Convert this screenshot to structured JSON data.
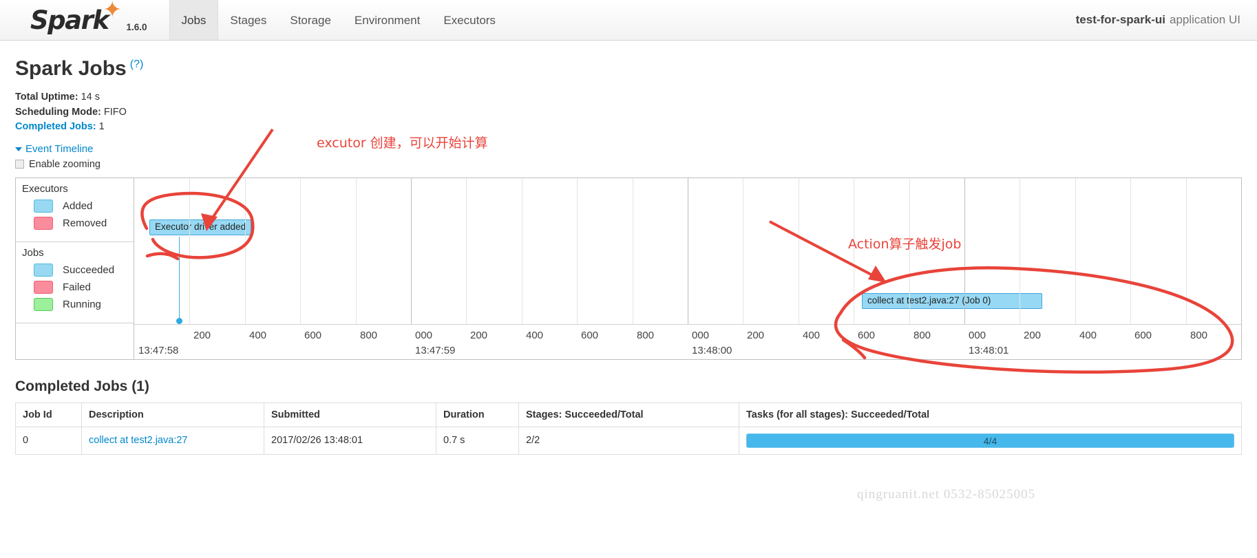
{
  "navbar": {
    "brand": "Spark",
    "version": "1.6.0",
    "tabs": [
      {
        "label": "Jobs",
        "active": true
      },
      {
        "label": "Stages",
        "active": false
      },
      {
        "label": "Storage",
        "active": false
      },
      {
        "label": "Environment",
        "active": false
      },
      {
        "label": "Executors",
        "active": false
      }
    ],
    "app_name": "test-for-spark-ui",
    "app_suffix": "application UI"
  },
  "page": {
    "title": "Spark Jobs",
    "help_marker": "(?)",
    "total_uptime_label": "Total Uptime:",
    "total_uptime_value": "14 s",
    "scheduling_mode_label": "Scheduling Mode:",
    "scheduling_mode_value": "FIFO",
    "completed_jobs_label": "Completed Jobs:",
    "completed_jobs_value": "1",
    "event_timeline_label": "Event Timeline",
    "enable_zooming_label": "Enable zooming"
  },
  "timeline": {
    "legend": {
      "executors_header": "Executors",
      "executors_items": [
        {
          "label": "Added",
          "color": "#98d9f1"
        },
        {
          "label": "Removed",
          "color": "#fa8c9b"
        }
      ],
      "jobs_header": "Jobs",
      "jobs_items": [
        {
          "label": "Succeeded",
          "color": "#98d9f1"
        },
        {
          "label": "Failed",
          "color": "#fa8c9b"
        },
        {
          "label": "Running",
          "color": "#9cf09c"
        }
      ]
    },
    "events": [
      {
        "label": "Executor driver added",
        "row": "executors"
      },
      {
        "label": "collect at test2.java:27 (Job 0)",
        "row": "jobs"
      }
    ],
    "axis": {
      "ms_ticks": [
        "200",
        "400",
        "600",
        "800",
        "000",
        "200",
        "400",
        "600",
        "800",
        "000",
        "200",
        "400",
        "600",
        "800",
        "000",
        "200",
        "400",
        "600",
        "800"
      ],
      "second_ticks": [
        "13:47:58",
        "13:47:59",
        "13:48:00",
        "13:48:01"
      ]
    }
  },
  "jobs_table": {
    "section_title": "Completed Jobs (1)",
    "columns": [
      "Job Id",
      "Description",
      "Submitted",
      "Duration",
      "Stages: Succeeded/Total",
      "Tasks (for all stages): Succeeded/Total"
    ],
    "rows": [
      {
        "job_id": "0",
        "description": "collect at test2.java:27",
        "submitted": "2017/02/26 13:48:01",
        "duration": "0.7 s",
        "stages": "2/2",
        "tasks_label": "4/4",
        "tasks_percent": 100
      }
    ]
  },
  "annotations": [
    {
      "name": "executor-note",
      "text": "excutor 创建，可以开始计算"
    },
    {
      "name": "action-note",
      "text": "Action算子触发job"
    }
  ],
  "watermark": "qingruanit.net  0532-85025005",
  "colors": {
    "accent_link": "#0088cc",
    "annotation_red": "#e8443a",
    "bar_blue": "#97d9f4",
    "progress_blue": "#46b8ec"
  }
}
